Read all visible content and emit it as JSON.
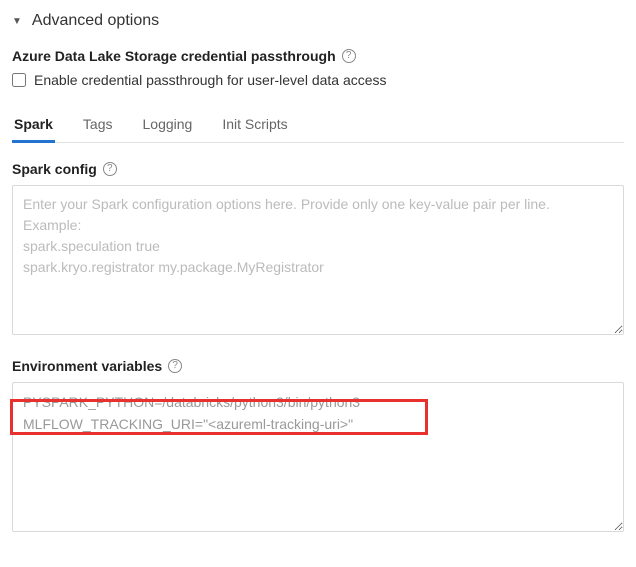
{
  "header": {
    "title": "Advanced options"
  },
  "adls": {
    "title": "Azure Data Lake Storage credential passthrough",
    "checkbox_label": "Enable credential passthrough for user-level data access"
  },
  "tabs": {
    "items": [
      {
        "label": "Spark",
        "active": true
      },
      {
        "label": "Tags",
        "active": false
      },
      {
        "label": "Logging",
        "active": false
      },
      {
        "label": "Init Scripts",
        "active": false
      }
    ]
  },
  "spark_config": {
    "label": "Spark config",
    "placeholder": "Enter your Spark configuration options here. Provide only one key-value pair per line.\nExample:\nspark.speculation true\nspark.kryo.registrator my.package.MyRegistrator",
    "value": ""
  },
  "env_vars": {
    "label": "Environment variables",
    "value": "PYSPARK_PYTHON=/databricks/python3/bin/python3\nMLFLOW_TRACKING_URI=\"<azureml-tracking-uri>\""
  }
}
